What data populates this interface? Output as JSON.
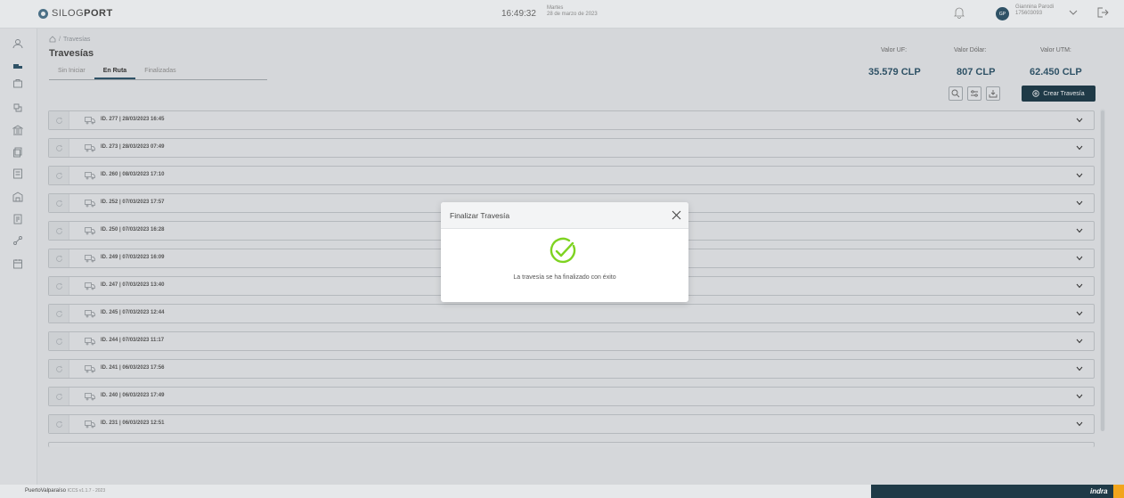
{
  "header": {
    "brand_light": "SILOG",
    "brand_bold": "PORT",
    "time": "16:49:32",
    "weekday": "Martes",
    "date": "28 de marzo de 2023",
    "user_initials": "GP",
    "user_name": "Giannina Parodi",
    "user_id": "175603093"
  },
  "breadcrumb": {
    "current": "Travesías"
  },
  "page_title": "Travesías",
  "tabs": [
    {
      "label": "Sin Iniciar",
      "active": false
    },
    {
      "label": "En Ruta",
      "active": true
    },
    {
      "label": "Finalizadas",
      "active": false
    }
  ],
  "indicators": [
    {
      "label": "Valor UF:",
      "value": "35.579 CLP"
    },
    {
      "label": "Valor Dólar:",
      "value": "807 CLP"
    },
    {
      "label": "Valor UTM:",
      "value": "62.450 CLP"
    }
  ],
  "create_button": "Crear Travesía",
  "rows": [
    "ID. 277 | 28/03/2023 16:45",
    "ID. 273 | 28/03/2023 07:49",
    "ID. 260 | 08/03/2023 17:10",
    "ID. 252 | 07/03/2023 17:57",
    "ID. 250 | 07/03/2023 16:28",
    "ID. 249 | 07/03/2023 16:09",
    "ID. 247 | 07/03/2023 13:40",
    "ID. 245 | 07/03/2023 12:44",
    "ID. 244 | 07/03/2023 11:17",
    "ID. 241 | 06/03/2023 17:56",
    "ID. 240 | 06/03/2023 17:49",
    "ID. 231 | 06/03/2023 12:51"
  ],
  "modal": {
    "title": "Finalizar Travesía",
    "message": "La travesía se ha finalizado con éxito"
  },
  "footer": {
    "brand": "PuertoValparaíso",
    "version": "ICCS v1.1.7 - 2023",
    "partner": "indra"
  },
  "colors": {
    "primary": "#1f3a47",
    "accent": "#f2a51c",
    "success": "#7ed321"
  }
}
